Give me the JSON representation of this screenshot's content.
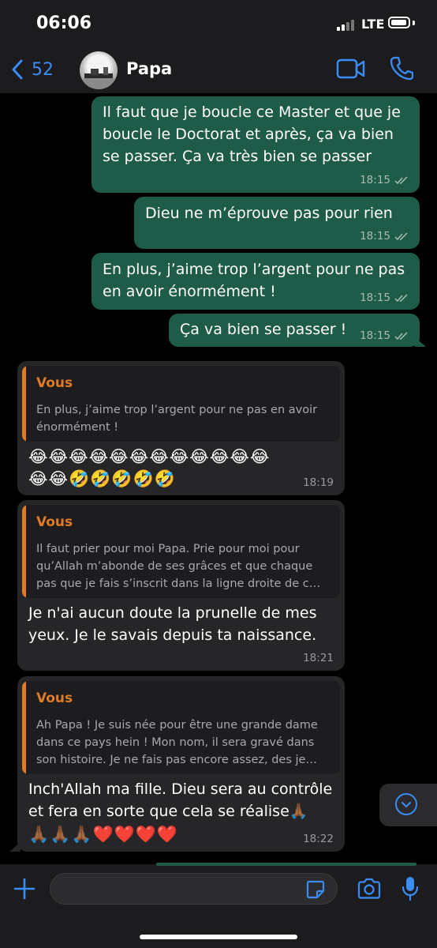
{
  "status_bar": {
    "time": "06:06",
    "network": "LTE"
  },
  "header": {
    "back_count": "52",
    "contact_name": "Papa"
  },
  "messages": [
    {
      "text_lines": [
        "Il faut que je boucle ce Master et que je",
        "boucle le Doctorat et après, ça va bien",
        "se passer. Ça va très bien se passer"
      ],
      "time": "18:15"
    },
    {
      "text_lines": [
        "Dieu ne m’éprouve pas pour rien"
      ],
      "time": "18:15"
    },
    {
      "text_lines": [
        "En plus, j’aime trop l’argent pour ne pas",
        "en avoir énormément !"
      ],
      "time": "18:15"
    },
    {
      "text_lines": [
        "Ça va bien se passer !"
      ],
      "time": "18:15"
    },
    {
      "quote_author": "Vous",
      "quote_lines": [
        "En plus, j’aime trop l’argent pour ne pas en avoir",
        "énormément !"
      ],
      "emoji_lines": [
        "😂😂😂😂😂😂😂😂😂😂😂😂",
        "😂😂🤣🤣🤣🤣🤣"
      ],
      "time": "18:19"
    },
    {
      "quote_author": "Vous",
      "quote_lines": [
        "Il faut prier pour moi Papa. Prie pour moi pour",
        "qu’Allah m’abonde de ses grâces et que chaque",
        "pas que je fais  s’inscrit dans la ligne droite de c…"
      ],
      "text_lines": [
        "Je n'ai aucun doute la prunelle de mes",
        "yeux. Je le savais depuis ta naissance."
      ],
      "time": "18:21"
    },
    {
      "quote_author": "Vous",
      "quote_lines": [
        "Ah Papa ! Je suis née pour être une grande dame",
        "dans ce pays hein ! Mon nom, il sera gravé dans",
        "son histoire. Je ne fais pas encore assez, des je…"
      ],
      "text_lines": [
        "Inch'Allah ma fille. Dieu sera au contrôle",
        "et fera en sorte que cela se réalise🙏🏾"
      ],
      "emoji_line": "🙏🏾🙏🏾🙏🏾❤️❤️❤️❤️",
      "time": "18:22"
    }
  ],
  "composer": {
    "value": "",
    "placeholder": ""
  },
  "icons": [
    "back-chevron-icon",
    "video-camera-icon",
    "phone-icon",
    "read-receipt-icon",
    "chevron-down-icon",
    "plus-icon",
    "sticker-icon",
    "camera-icon",
    "microphone-icon"
  ],
  "colors": {
    "accent": "#3b8cf5",
    "outgoing_bubble": "#1f5b49",
    "incoming_bubble": "#262628",
    "quote_author": "#e07b26"
  }
}
